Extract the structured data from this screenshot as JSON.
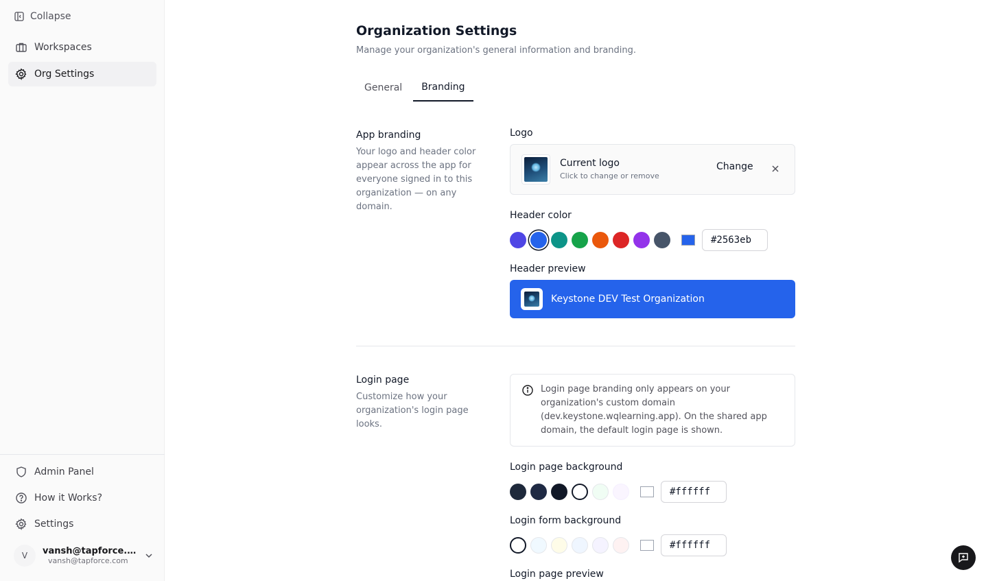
{
  "sidebar": {
    "collapse_label": "Collapse",
    "items": [
      {
        "label": "Workspaces",
        "icon": "briefcase-icon"
      },
      {
        "label": "Org Settings",
        "icon": "gear-icon",
        "active": true
      }
    ],
    "bottom_items": [
      {
        "label": "Admin Panel",
        "icon": "shield-icon"
      },
      {
        "label": "How it Works?",
        "icon": "question-circle-icon"
      },
      {
        "label": "Settings",
        "icon": "gear-icon"
      }
    ],
    "user": {
      "initial": "V",
      "name": "vansh@tapforce.c...",
      "email": "vansh@tapforce.com"
    }
  },
  "page": {
    "title": "Organization Settings",
    "subtitle": "Manage your organization's general information and branding.",
    "tabs": [
      {
        "label": "General",
        "active": false
      },
      {
        "label": "Branding",
        "active": true
      }
    ]
  },
  "app_branding": {
    "title": "App branding",
    "description": "Your logo and header color appear across the app for everyone signed in to this organization — on any domain.",
    "logo": {
      "label": "Logo",
      "title": "Current logo",
      "hint": "Click to change or remove",
      "change_label": "Change"
    },
    "header_color": {
      "label": "Header color",
      "swatches": [
        "#4f46e5",
        "#2563eb",
        "#0d9488",
        "#16a34a",
        "#ea580c",
        "#dc2626",
        "#9333ea",
        "#475569"
      ],
      "selected": "#2563eb",
      "value": "#2563eb"
    },
    "header_preview": {
      "label": "Header preview",
      "org_name": "Keystone DEV Test Organization"
    }
  },
  "login_page": {
    "title": "Login page",
    "description": "Customize how your organization's login page looks.",
    "info": "Login page branding only appears on your organization's custom domain (dev.keystone.wqlearning.app). On the shared app domain, the default login page is shown.",
    "background": {
      "label": "Login page background",
      "swatches": [
        "#1e293b",
        "#1f2a44",
        "#111827",
        "#ffffff",
        "#f0fdf4",
        "#faf5ff"
      ],
      "selected": "#ffffff",
      "value": "#ffffff"
    },
    "form_background": {
      "label": "Login form background",
      "swatches": [
        "#ffffff",
        "#f0f9ff",
        "#fefce8",
        "#eff6ff",
        "#f5f3ff",
        "#fef2f2"
      ],
      "selected": "#ffffff",
      "value": "#ffffff"
    },
    "preview_label": "Login page preview"
  },
  "colors": {
    "accent": "#2563eb",
    "sidebar_bg": "#fafafa",
    "text_primary": "#111827",
    "text_secondary": "#6b7280"
  }
}
